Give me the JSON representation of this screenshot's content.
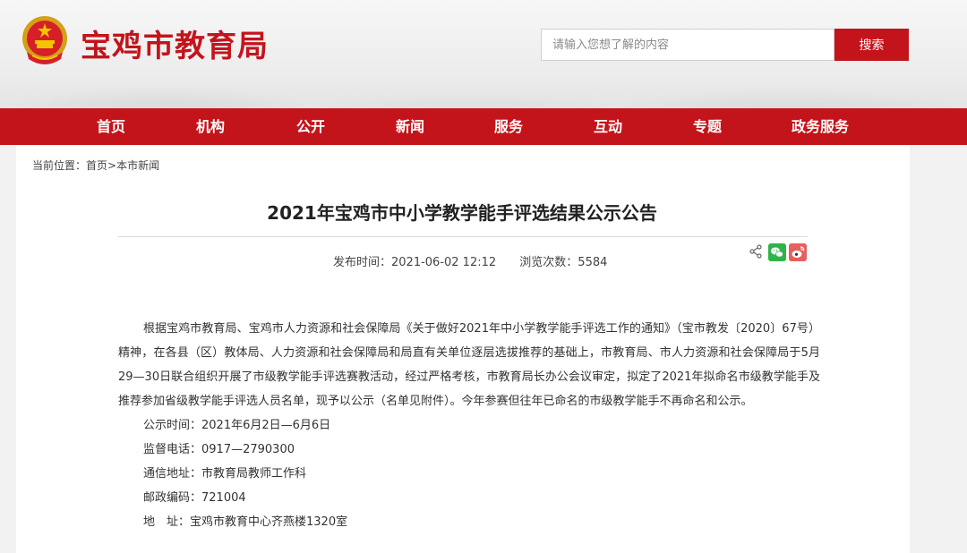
{
  "header": {
    "site_title": "宝鸡市教育局",
    "search_placeholder": "请输入您想了解的内容",
    "search_button": "搜索"
  },
  "nav": {
    "items": [
      {
        "label": "首页"
      },
      {
        "label": "机构"
      },
      {
        "label": "公开"
      },
      {
        "label": "新闻"
      },
      {
        "label": "服务"
      },
      {
        "label": "互动"
      },
      {
        "label": "专题"
      },
      {
        "label": "政务服务"
      }
    ]
  },
  "breadcrumb": {
    "prefix": "当前位置：",
    "home": "首页",
    "separator": ">",
    "current": "本市新闻"
  },
  "article": {
    "title": "2021年宝鸡市中小学教学能手评选结果公示公告",
    "publish_time": "发布时间：2021-06-02 12:12",
    "views": "浏览次数：5584",
    "paragraph": "根据宝鸡市教育局、宝鸡市人力资源和社会保障局《关于做好2021年中小学教学能手评选工作的通知》（宝市教发〔2020〕67号）精神，在各县（区）教体局、人力资源和社会保障局和局直有关单位逐层选拔推荐的基础上，市教育局、市人力资源和社会保障局于5月29—30日联合组织开展了市级教学能手评选赛教活动，经过严格考核，市教育局长办公会议审定，拟定了2021年拟命名市级教学能手及推荐参加省级教学能手评选人员名单，现予以公示（名单见附件）。今年参赛但往年已命名的市级教学能手不再命名和公示。",
    "info": [
      "公示时间：2021年6月2日—6月6日",
      "监督电话：0917—2790300",
      "通信地址：市教育局教师工作科",
      "邮政编码：721004",
      "地　址：宝鸡市教育中心齐燕楼1320室"
    ]
  },
  "colors": {
    "brand_red": "#c4141b",
    "wechat_green": "#2fb44a",
    "weibo_red": "#e6605d"
  },
  "icons": {
    "emblem": "national-emblem-icon",
    "share": "share-icon",
    "wechat": "wechat-icon",
    "weibo": "weibo-icon"
  }
}
